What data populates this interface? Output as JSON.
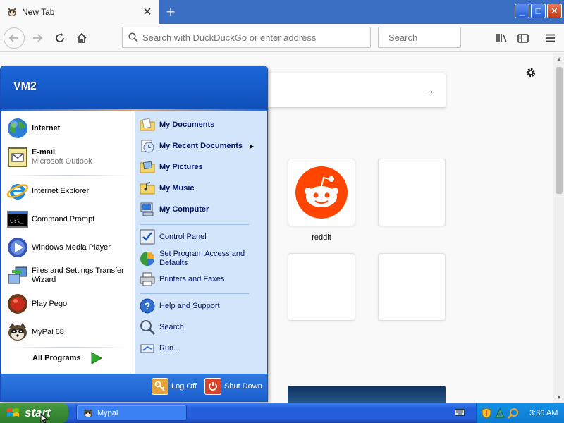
{
  "browser": {
    "tab_title": "New Tab",
    "new_tab_symbol": "+",
    "window_buttons": {
      "minimize": "_",
      "maximize": "□",
      "close": "✕"
    },
    "url_placeholder": "Search with DuckDuckGo or enter address",
    "search_placeholder": "Search"
  },
  "page": {
    "tiles": [
      {
        "label": "reddit",
        "icon": "reddit-icon",
        "color": "#ff4500"
      },
      {
        "label": ""
      },
      {
        "label": ""
      },
      {
        "label": ""
      }
    ]
  },
  "start_menu": {
    "user": "VM2",
    "pinned": [
      {
        "label": "Internet",
        "icon": "globe-icon"
      },
      {
        "label": "E-mail",
        "sublabel": "Microsoft Outlook",
        "icon": "outlook-icon"
      }
    ],
    "recent": [
      {
        "label": "Internet Explorer",
        "icon": "ie-icon"
      },
      {
        "label": "Command Prompt",
        "icon": "cmd-icon"
      },
      {
        "label": "Windows Media Player",
        "icon": "media-player-icon"
      },
      {
        "label": "Files and Settings Transfer Wizard",
        "icon": "transfer-wizard-icon"
      },
      {
        "label": "Play Pego",
        "icon": "pego-icon"
      },
      {
        "label": "MyPal 68",
        "icon": "mypal-icon"
      }
    ],
    "all_programs": "All Programs",
    "places": [
      {
        "label": "My Documents"
      },
      {
        "label": "My Recent Documents"
      },
      {
        "label": "My Pictures"
      },
      {
        "label": "My Music"
      },
      {
        "label": "My Computer"
      }
    ],
    "settings": [
      {
        "label": "Control Panel"
      },
      {
        "label": "Set Program Access and Defaults"
      },
      {
        "label": "Printers and Faxes"
      }
    ],
    "help": [
      {
        "label": "Help and Support"
      },
      {
        "label": "Search"
      },
      {
        "label": "Run..."
      }
    ],
    "log_off": "Log Off",
    "shut_down": "Shut Down"
  },
  "taskbar": {
    "start_label": "start",
    "task_label": "Mypal",
    "clock": "3:36 AM"
  },
  "colors": {
    "xp_blue": "#245edb",
    "start_green": "#3a8f36",
    "reddit_orange": "#ff4500"
  }
}
